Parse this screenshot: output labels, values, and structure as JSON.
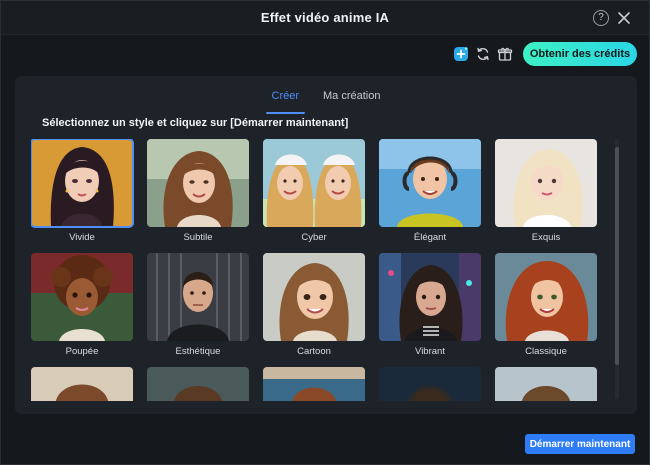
{
  "window": {
    "title": "Effet vidéo anime IA"
  },
  "toolbar": {
    "credits_label": "Obtenir des crédits"
  },
  "tabs": [
    {
      "label": "Créer",
      "active": true
    },
    {
      "label": "Ma création",
      "active": false
    }
  ],
  "instruction": "Sélectionnez un style et cliquez sur [Démarrer maintenant]",
  "styles": [
    {
      "label": "Vivide",
      "selected": true
    },
    {
      "label": "Subtile",
      "selected": false
    },
    {
      "label": "Cyber",
      "selected": false
    },
    {
      "label": "Élégant",
      "selected": false
    },
    {
      "label": "Exquis",
      "selected": false
    },
    {
      "label": "Poupée",
      "selected": false
    },
    {
      "label": "Esthétique",
      "selected": false
    },
    {
      "label": "Cartoon",
      "selected": false
    },
    {
      "label": "Vibrant",
      "selected": false
    },
    {
      "label": "Classique",
      "selected": false
    }
  ],
  "footer": {
    "start_label": "Démarrer maintenant"
  },
  "colors": {
    "accent": "#2e7cf6",
    "credits_gradient_start": "#3ef0c4",
    "credits_gradient_end": "#2ad6e6",
    "tab_active": "#4f8ef7"
  },
  "icons": [
    "help-icon",
    "close-icon",
    "add-ai-icon",
    "refresh-icon",
    "gift-icon"
  ]
}
